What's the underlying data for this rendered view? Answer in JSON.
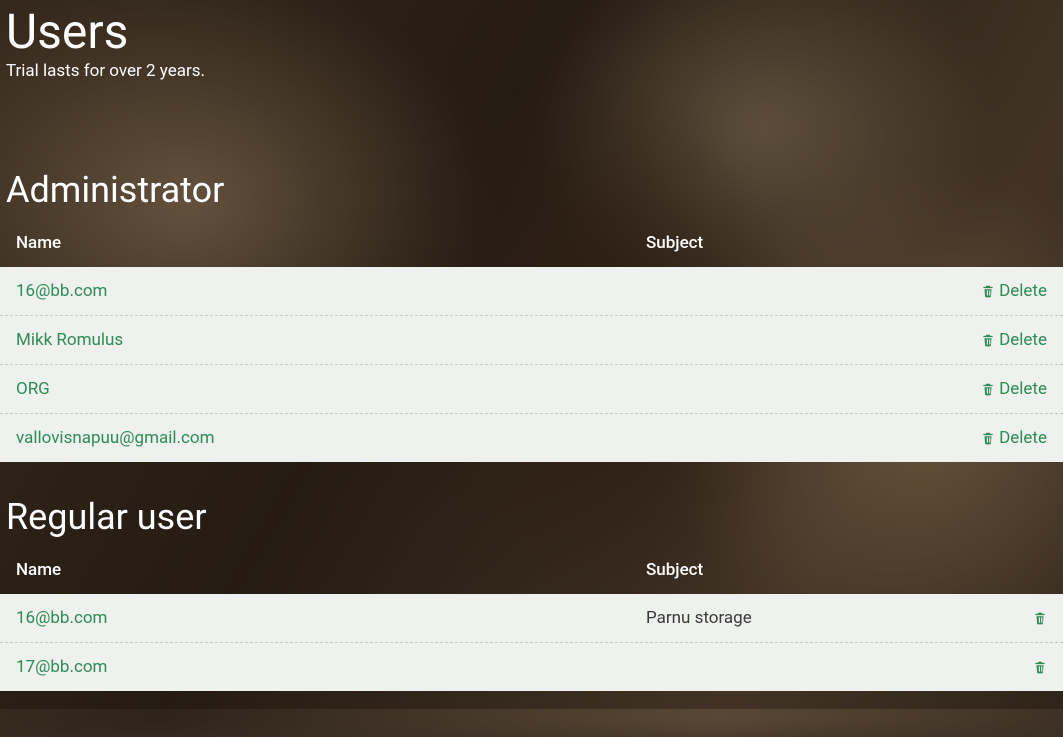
{
  "page": {
    "title": "Users",
    "subtitle": "Trial lasts for over 2 years."
  },
  "labels": {
    "delete": "Delete"
  },
  "columns": {
    "name": "Name",
    "subject": "Subject"
  },
  "sections": {
    "admin": {
      "title": "Administrator",
      "rows": [
        {
          "name": "16@bb.com",
          "subject": ""
        },
        {
          "name": "Mikk Romulus",
          "subject": ""
        },
        {
          "name": "ORG",
          "subject": ""
        },
        {
          "name": "vallovisnapuu@gmail.com",
          "subject": ""
        }
      ]
    },
    "regular": {
      "title": "Regular user",
      "rows": [
        {
          "name": "16@bb.com",
          "subject": "Parnu storage"
        },
        {
          "name": "17@bb.com",
          "subject": ""
        }
      ]
    }
  },
  "colors": {
    "link": "#2e8b57",
    "panel": "#eef1ed"
  }
}
